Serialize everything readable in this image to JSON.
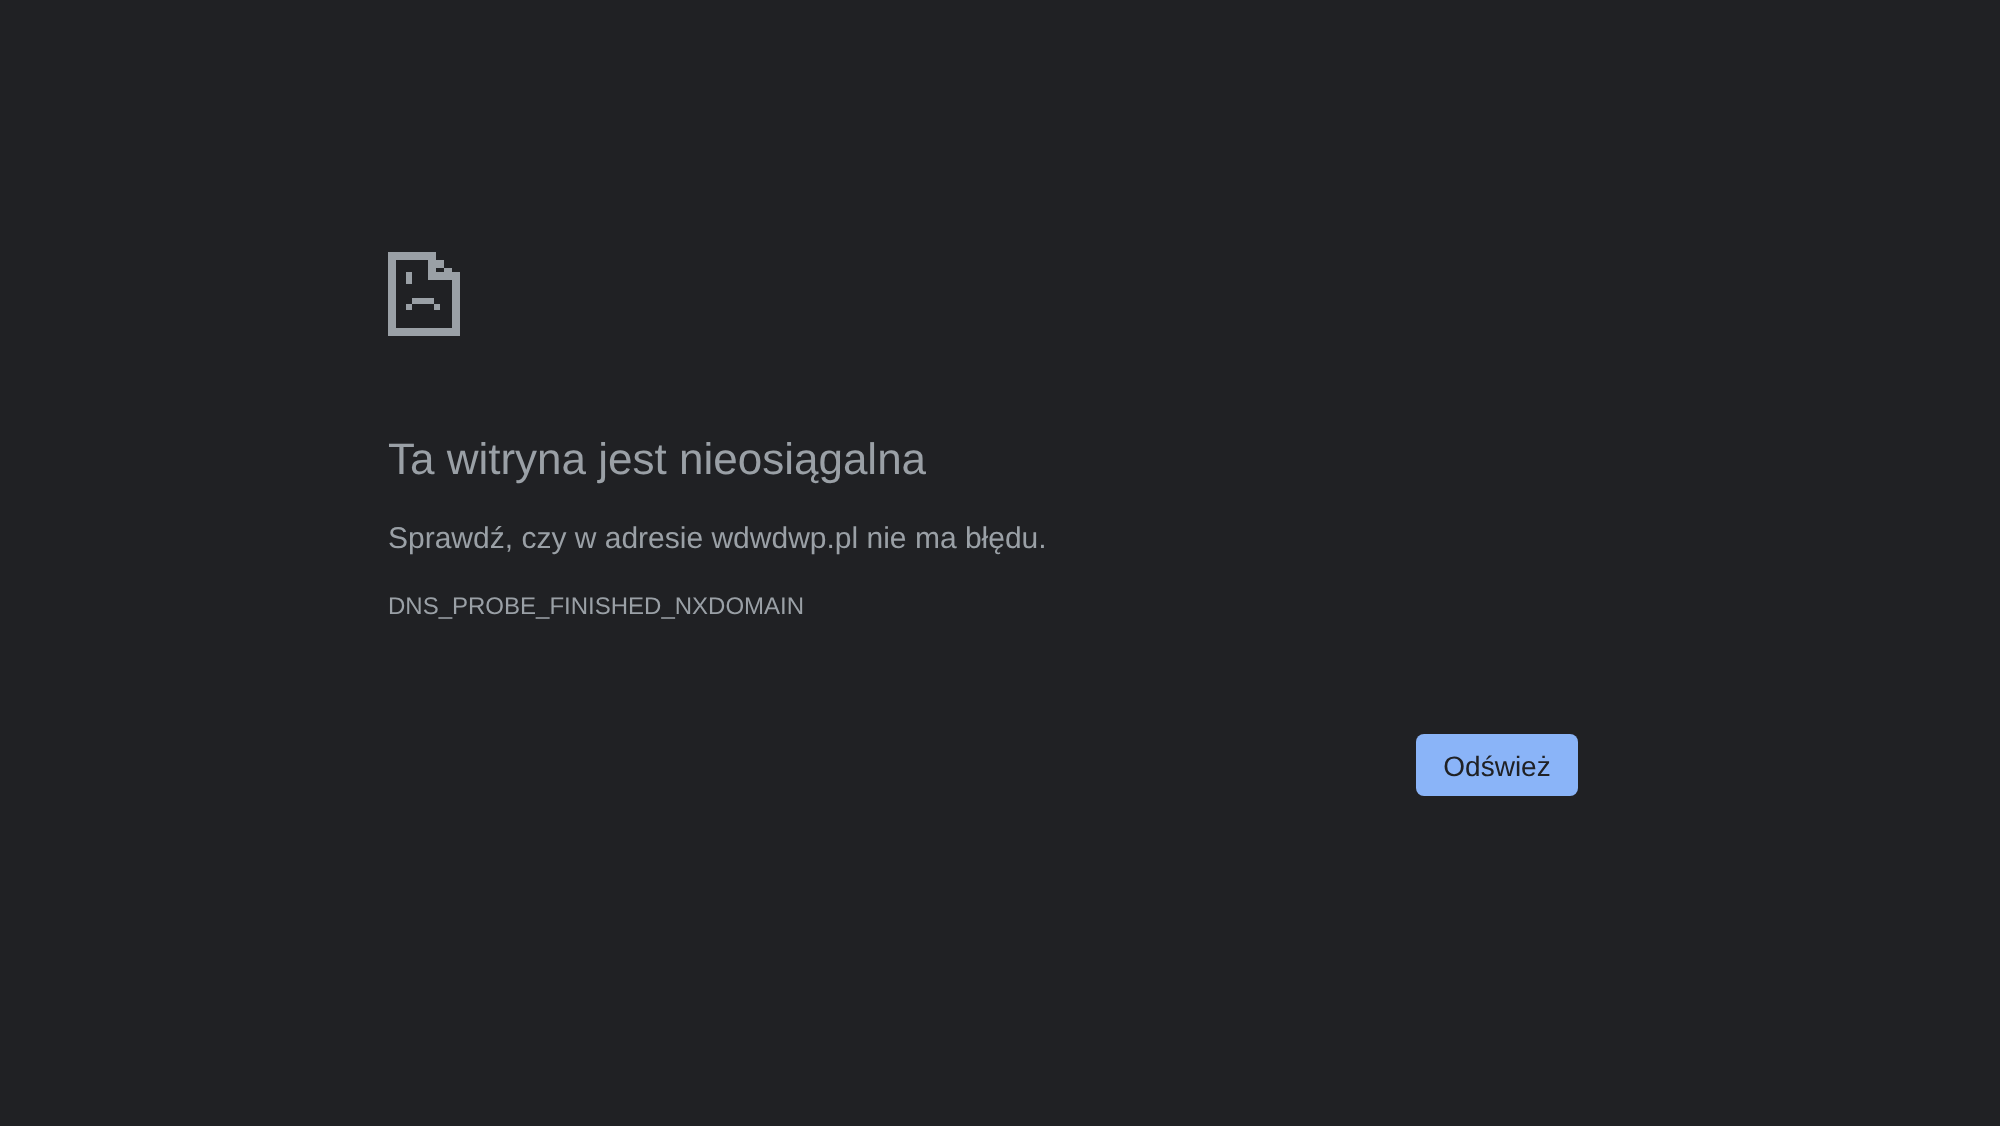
{
  "error_page": {
    "heading": "Ta witryna jest nieosiągalna",
    "message": "Sprawdź, czy w adresie wdwdwp.pl nie ma błędu.",
    "error_code": "DNS_PROBE_FINISHED_NXDOMAIN",
    "buttons": [
      {
        "label": "Odśwież"
      }
    ]
  }
}
